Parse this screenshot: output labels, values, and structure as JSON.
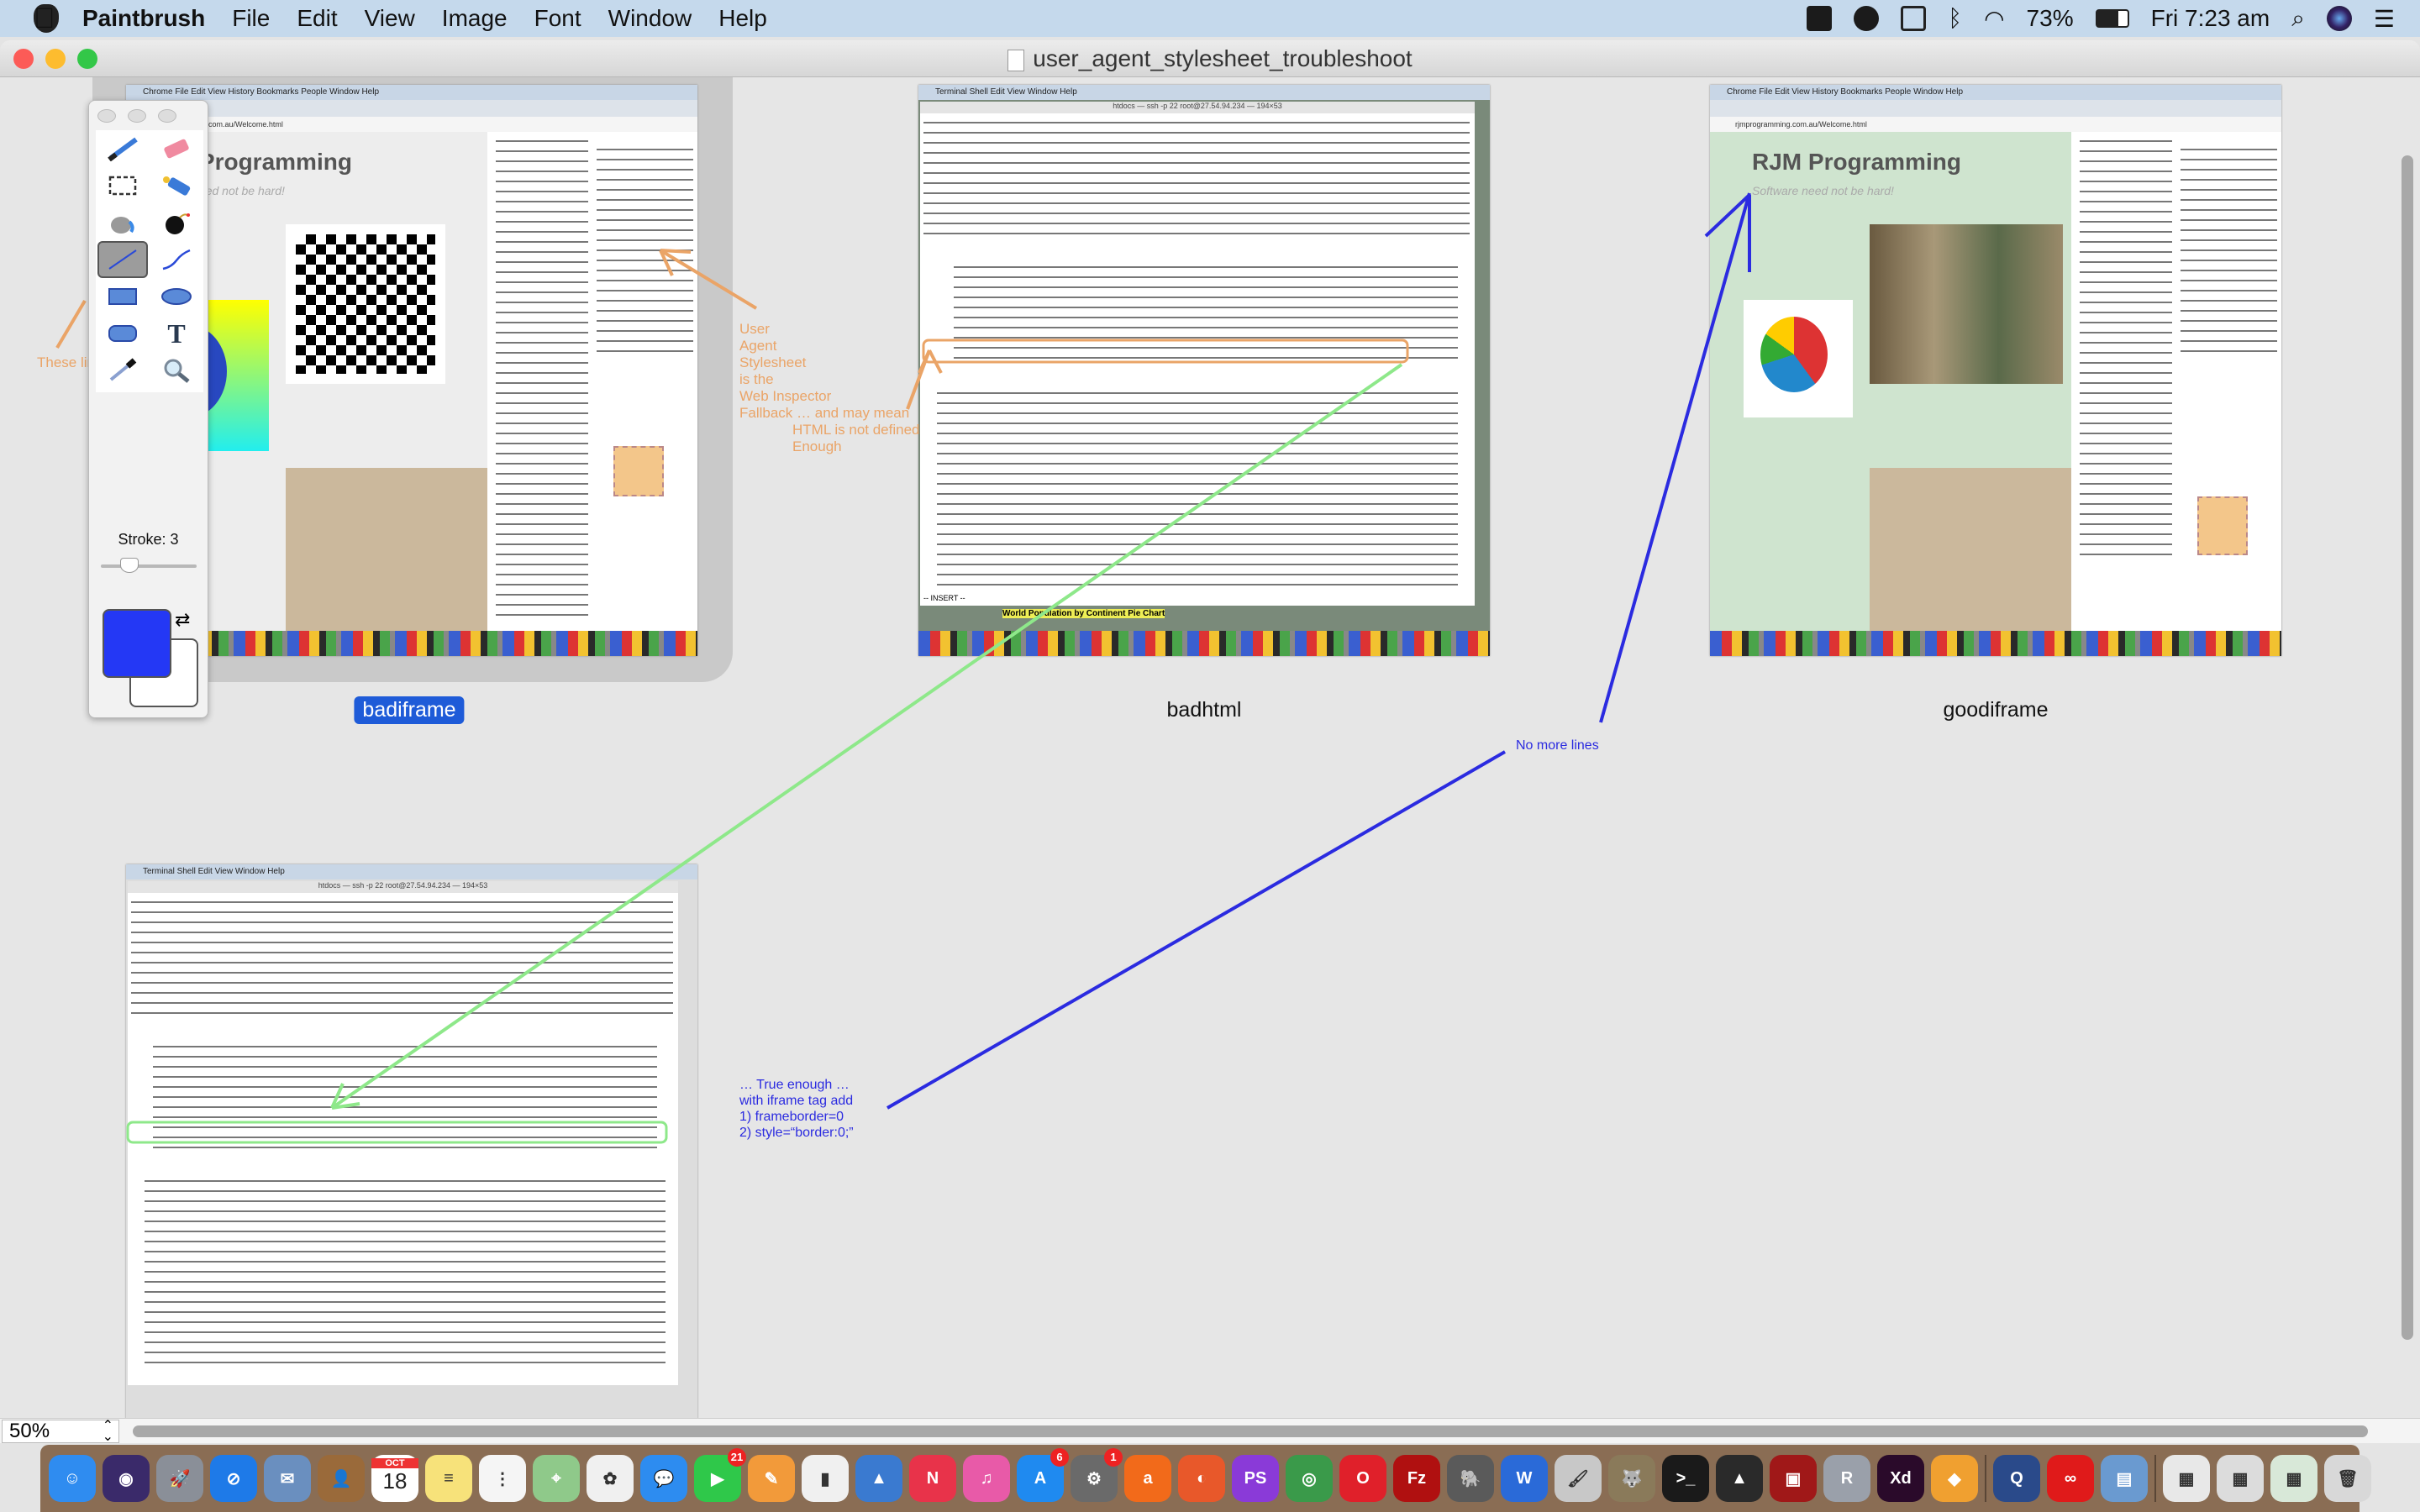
{
  "menubar": {
    "app_name": "Paintbrush",
    "items": [
      "File",
      "Edit",
      "View",
      "Image",
      "Font",
      "Window",
      "Help"
    ],
    "battery": "73%",
    "clock": "Fri 7:23 am",
    "status_icons": [
      "malwarebytes-icon",
      "m-icon",
      "airplay-icon",
      "bluetooth-icon",
      "wifi-icon",
      "battery-icon",
      "search-icon",
      "siri-icon",
      "list-icon"
    ]
  },
  "window": {
    "title": "user_agent_stylesheet_troubleshoot"
  },
  "thumbnails": [
    {
      "label": "badiframe",
      "selected": true
    },
    {
      "label": "badhtml",
      "selected": false
    },
    {
      "label": "goodiframe",
      "selected": false
    },
    {
      "label": "",
      "selected": false
    }
  ],
  "thumb_text": {
    "chrome_menu": "Chrome  File  Edit  View  History  Bookmarks  People  Window  Help",
    "terminal_menu": "Terminal  Shell  Edit  View  Window  Help",
    "site_title": "RJM Programming",
    "site_tagline": "Software need not be hard!",
    "pie_caption": "World Population by Continent Pie Chart",
    "terminal_title": "htdocs — ssh -p 22 root@27.54.94.234 — 194×53",
    "address": "rjmprogramming.com.au/Welcome.html",
    "insert_mode": "-- INSERT --"
  },
  "annotations": {
    "these_lines": "These lines annoy",
    "user_agent": [
      "User",
      "Agent",
      "Stylesheet",
      "is the",
      "Web Inspector",
      "Fallback … and may mean"
    ],
    "user_agent_cont": [
      "HTML is not defined",
      "Enough"
    ],
    "no_more_lines": "No more lines",
    "true_enough": [
      "… True enough …",
      "with iframe tag add",
      "1) frameborder=0",
      "2) style=“border:0;”"
    ],
    "colors": {
      "orange": "#eaa467",
      "green": "#8ee88a",
      "blue": "#2b2be0"
    }
  },
  "palette": {
    "tools": [
      "paintbrush",
      "eraser",
      "selection",
      "spray",
      "bucket",
      "bomb",
      "line",
      "curve",
      "rectangle",
      "ellipse",
      "rounded-rectangle",
      "text",
      "eyedropper",
      "magnifier"
    ],
    "active_tool": "line",
    "stroke_label": "Stroke: 3",
    "stroke_value": 3,
    "stroke_max": 10,
    "foreground_color": "#2438f5",
    "background_color": "#ffffff"
  },
  "bottom": {
    "zoom": "50%"
  },
  "dock": [
    {
      "name": "Finder",
      "color": "#2f8cf0",
      "glyph": "☺"
    },
    {
      "name": "Siri",
      "color": "#3a2a6a",
      "glyph": "◉"
    },
    {
      "name": "Launchpad",
      "color": "#8a8f98",
      "glyph": "🚀"
    },
    {
      "name": "Safari",
      "color": "#1e7ae8",
      "glyph": "⊘"
    },
    {
      "name": "Mail",
      "color": "#6a8fbf",
      "glyph": "✉"
    },
    {
      "name": "Contacts",
      "color": "#9a6a3a",
      "glyph": "👤"
    },
    {
      "name": "Calendar",
      "color": "#ffffff",
      "glyph": "18",
      "month": "OCT"
    },
    {
      "name": "Notes",
      "color": "#f7e27a",
      "glyph": "≡"
    },
    {
      "name": "Reminders",
      "color": "#f5f5f5",
      "glyph": "⋮"
    },
    {
      "name": "Maps",
      "color": "#8fc98a",
      "glyph": "⌖"
    },
    {
      "name": "Photos",
      "color": "#f0f0f0",
      "glyph": "✿"
    },
    {
      "name": "Messages",
      "color": "#2d8cf0",
      "glyph": "💬"
    },
    {
      "name": "FaceTime",
      "color": "#2fc84a",
      "glyph": "▶",
      "badge": "21"
    },
    {
      "name": "Pages",
      "color": "#f29a3a",
      "glyph": "✎"
    },
    {
      "name": "Numbers",
      "color": "#f0f0f0",
      "glyph": "▮"
    },
    {
      "name": "Keynote",
      "color": "#3a7ad0",
      "glyph": "▲"
    },
    {
      "name": "News",
      "color": "#e8334a",
      "glyph": "N"
    },
    {
      "name": "iTunes",
      "color": "#e85aa8",
      "glyph": "♫"
    },
    {
      "name": "App Store",
      "color": "#1f8af0",
      "glyph": "A",
      "badge": "6"
    },
    {
      "name": "System Preferences",
      "color": "#6a6a6a",
      "glyph": "⚙",
      "badge": "1"
    },
    {
      "name": "Avast",
      "color": "#f26a1a",
      "glyph": "a"
    },
    {
      "name": "Firefox",
      "color": "#e8582a",
      "glyph": "◐"
    },
    {
      "name": "PhpStorm",
      "color": "#8a3ad8",
      "glyph": "PS"
    },
    {
      "name": "Chrome",
      "color": "#3a9a4a",
      "glyph": "◎"
    },
    {
      "name": "Opera",
      "color": "#e0202a",
      "glyph": "O"
    },
    {
      "name": "FileZilla",
      "color": "#b01010",
      "glyph": "Fz"
    },
    {
      "name": "Sequel Pro",
      "color": "#5a5a5a",
      "glyph": "🐘"
    },
    {
      "name": "BBEdit",
      "color": "#2a6ad8",
      "glyph": "W"
    },
    {
      "name": "Paintbrush",
      "color": "#c8c8c8",
      "glyph": "🖌"
    },
    {
      "name": "GIMP",
      "color": "#8a7a5a",
      "glyph": "🐺"
    },
    {
      "name": "Terminal",
      "color": "#1a1a1a",
      "glyph": ">_"
    },
    {
      "name": "Inkscape",
      "color": "#2a2a2a",
      "glyph": "▲"
    },
    {
      "name": "Photo Booth",
      "color": "#a01818",
      "glyph": "▣"
    },
    {
      "name": "R",
      "color": "#9aa0aa",
      "glyph": "R"
    },
    {
      "name": "Adobe XD",
      "color": "#2a0a2a",
      "glyph": "Xd"
    },
    {
      "name": "Sketch-like",
      "color": "#f0a030",
      "glyph": "◆"
    },
    {
      "name": "QuickTime",
      "color": "#2a4a8a",
      "glyph": "Q"
    },
    {
      "name": "Creative Cloud",
      "color": "#e01a1a",
      "glyph": "∞"
    },
    {
      "name": "Preview",
      "color": "#6a9ad0",
      "glyph": "▤"
    },
    {
      "name": "Downloads stack",
      "color": "#e8e8e8",
      "glyph": "▦"
    },
    {
      "name": "Recent stack",
      "color": "#dcdcdc",
      "glyph": "▦"
    },
    {
      "name": "Window stack",
      "color": "#d8e8d8",
      "glyph": "▦"
    },
    {
      "name": "Trash",
      "color": "#d8d8d8",
      "glyph": "🗑"
    }
  ]
}
